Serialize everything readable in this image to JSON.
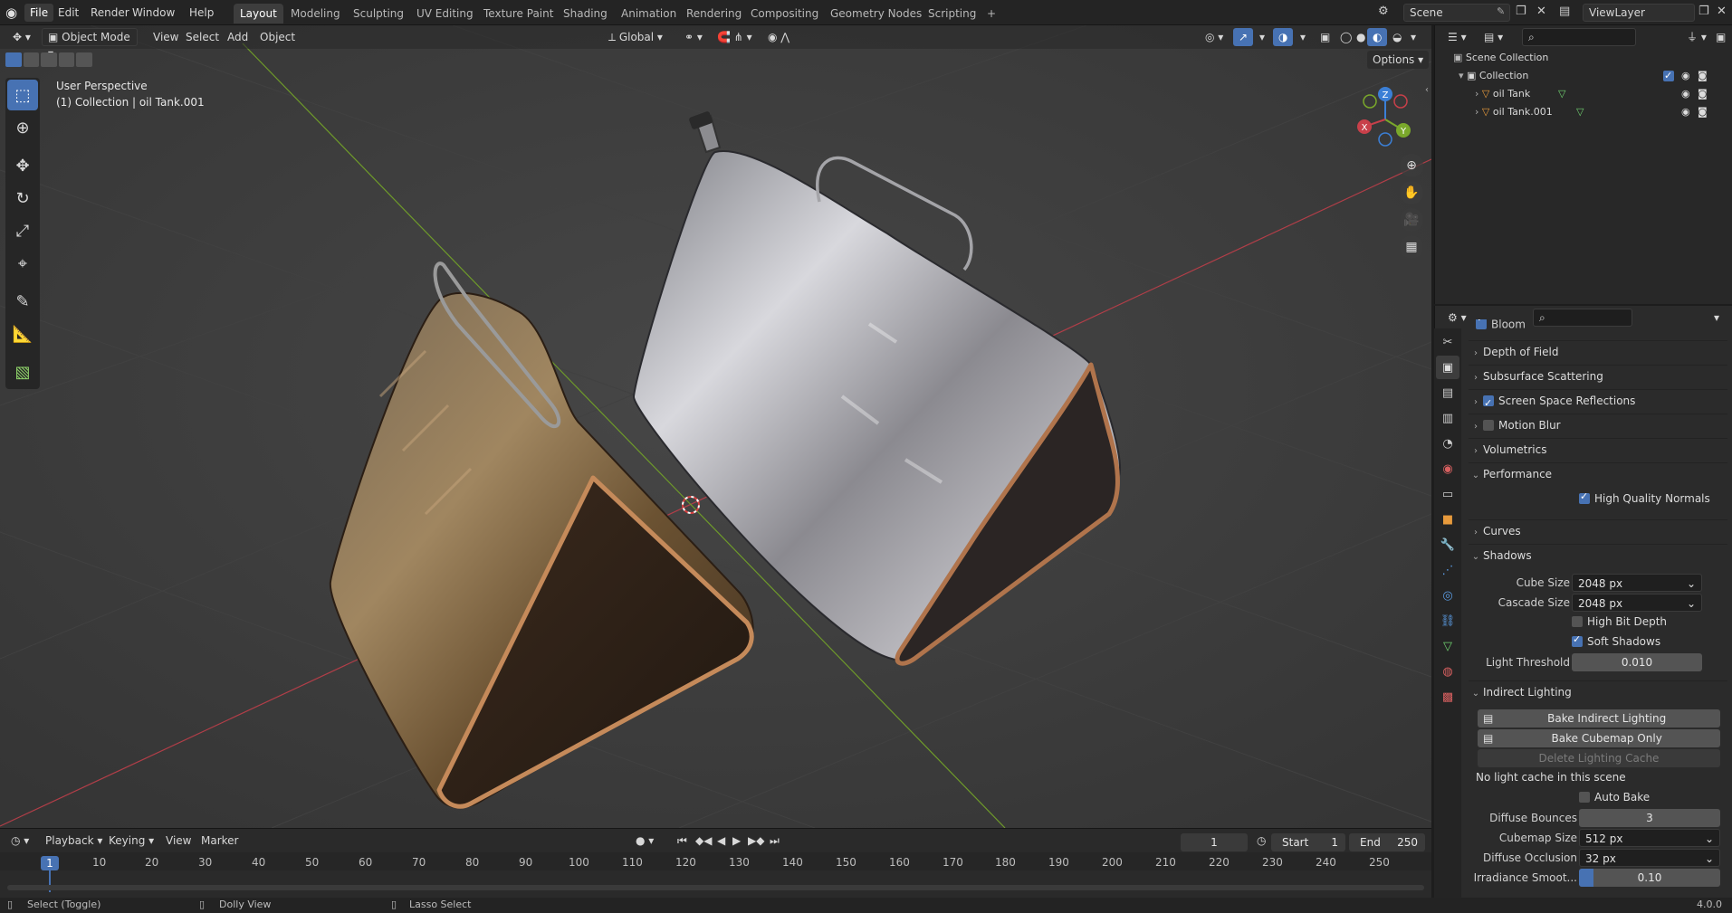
{
  "topbar": {
    "menus": [
      "File",
      "Edit",
      "Render",
      "Window",
      "Help"
    ],
    "workspaces": [
      "Layout",
      "Modeling",
      "Sculpting",
      "UV Editing",
      "Texture Paint",
      "Shading",
      "Animation",
      "Rendering",
      "Compositing",
      "Geometry Nodes",
      "Scripting"
    ],
    "add_tab": "+",
    "scene": "Scene",
    "view_layer": "ViewLayer"
  },
  "viewport": {
    "mode": "Object Mode",
    "menus": [
      "View",
      "Select",
      "Add",
      "Object"
    ],
    "orientation": "Global",
    "options": "Options",
    "overlay_title": "User Perspective",
    "overlay_subtitle": "(1) Collection | oil Tank.001",
    "gizmo_axes": {
      "z": "Z",
      "y": "Y",
      "x": "X"
    }
  },
  "outliner": {
    "search_placeholder": "",
    "root": "Scene Collection",
    "collection": "Collection",
    "items": [
      "oil Tank",
      "oil Tank.001"
    ]
  },
  "properties": {
    "search_placeholder": "",
    "partial_top": "Bloom",
    "sections": {
      "depth_of_field": "Depth of Field",
      "subsurface": "Subsurface Scattering",
      "ssr": "Screen Space Reflections",
      "motion_blur": "Motion Blur",
      "volumetrics": "Volumetrics",
      "performance": "Performance",
      "high_quality_normals": "High Quality Normals",
      "curves": "Curves",
      "shadows": "Shadows",
      "indirect": "Indirect Lighting"
    },
    "shadows": {
      "cube_size_label": "Cube Size",
      "cube_size": "2048 px",
      "cascade_size_label": "Cascade Size",
      "cascade_size": "2048 px",
      "high_bit_depth": "High Bit Depth",
      "soft_shadows": "Soft Shadows",
      "light_threshold_label": "Light Threshold",
      "light_threshold": "0.010"
    },
    "indirect": {
      "bake_indirect": "Bake Indirect Lighting",
      "bake_cubemap": "Bake Cubemap Only",
      "delete_cache": "Delete Lighting Cache",
      "cache_status": "No light cache in this scene",
      "auto_bake": "Auto Bake",
      "diffuse_bounces_label": "Diffuse Bounces",
      "diffuse_bounces": "3",
      "cubemap_size_label": "Cubemap Size",
      "cubemap_size": "512 px",
      "diffuse_occlusion_label": "Diffuse Occlusion",
      "diffuse_occlusion": "32 px",
      "irradiance_smooth_label": "Irradiance Smoot...",
      "irradiance_smooth": "0.10"
    }
  },
  "timeline": {
    "menus": [
      "Playback",
      "Keying",
      "View",
      "Marker"
    ],
    "current_frame": "1",
    "start_label": "Start",
    "start": "1",
    "end_label": "End",
    "end": "250",
    "ticks": [
      "1",
      "10",
      "20",
      "30",
      "40",
      "50",
      "60",
      "70",
      "80",
      "90",
      "100",
      "110",
      "120",
      "130",
      "140",
      "150",
      "160",
      "170",
      "180",
      "190",
      "200",
      "210",
      "220",
      "230",
      "240",
      "250"
    ]
  },
  "status": {
    "select": "Select (Toggle)",
    "dolly": "Dolly View",
    "lasso": "Lasso Select",
    "version": "4.0.0"
  },
  "colors": {
    "accent": "#4772b3",
    "x_axis": "#c8404a",
    "y_axis": "#7aa82b",
    "z_axis": "#3b7fd6"
  }
}
